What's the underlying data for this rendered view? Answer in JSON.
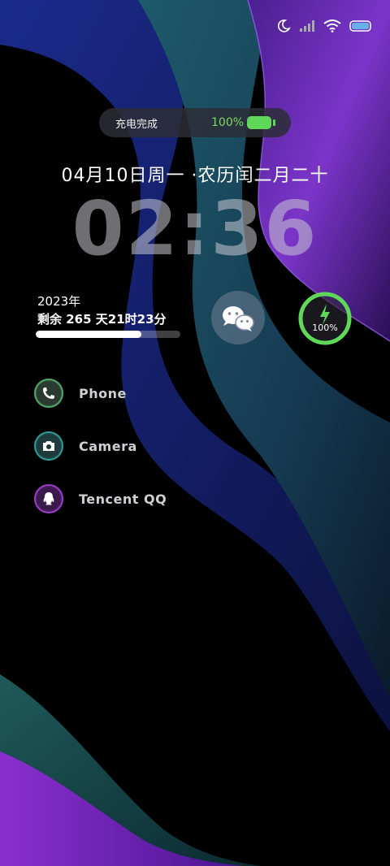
{
  "status_bar": {
    "icons": [
      "moon-icon",
      "signal-icon",
      "wifi-icon",
      "battery-icon"
    ]
  },
  "charging": {
    "label": "充电完成",
    "percent_text": "100%",
    "color": "#5fd85a"
  },
  "date_line": "04月10日周一  ·农历闰二月二十",
  "clock": "02:36",
  "year_widget": {
    "year": "2023年",
    "remaining": "剩余 265 天21时23分",
    "progress_fraction": 0.73
  },
  "wechat": {
    "icon": "wechat-icon"
  },
  "battery_ring": {
    "percent_text": "100%",
    "level_fraction": 1.0,
    "color": "#5fd85a",
    "icon": "lightning-icon"
  },
  "apps": [
    {
      "label": "Phone",
      "icon": "phone-icon",
      "color": "#4fa86a"
    },
    {
      "label": "Camera",
      "icon": "camera-icon",
      "color": "#2e9a95"
    },
    {
      "label": "Tencent QQ",
      "icon": "penguin-icon",
      "color": "#9a3cc8"
    }
  ]
}
